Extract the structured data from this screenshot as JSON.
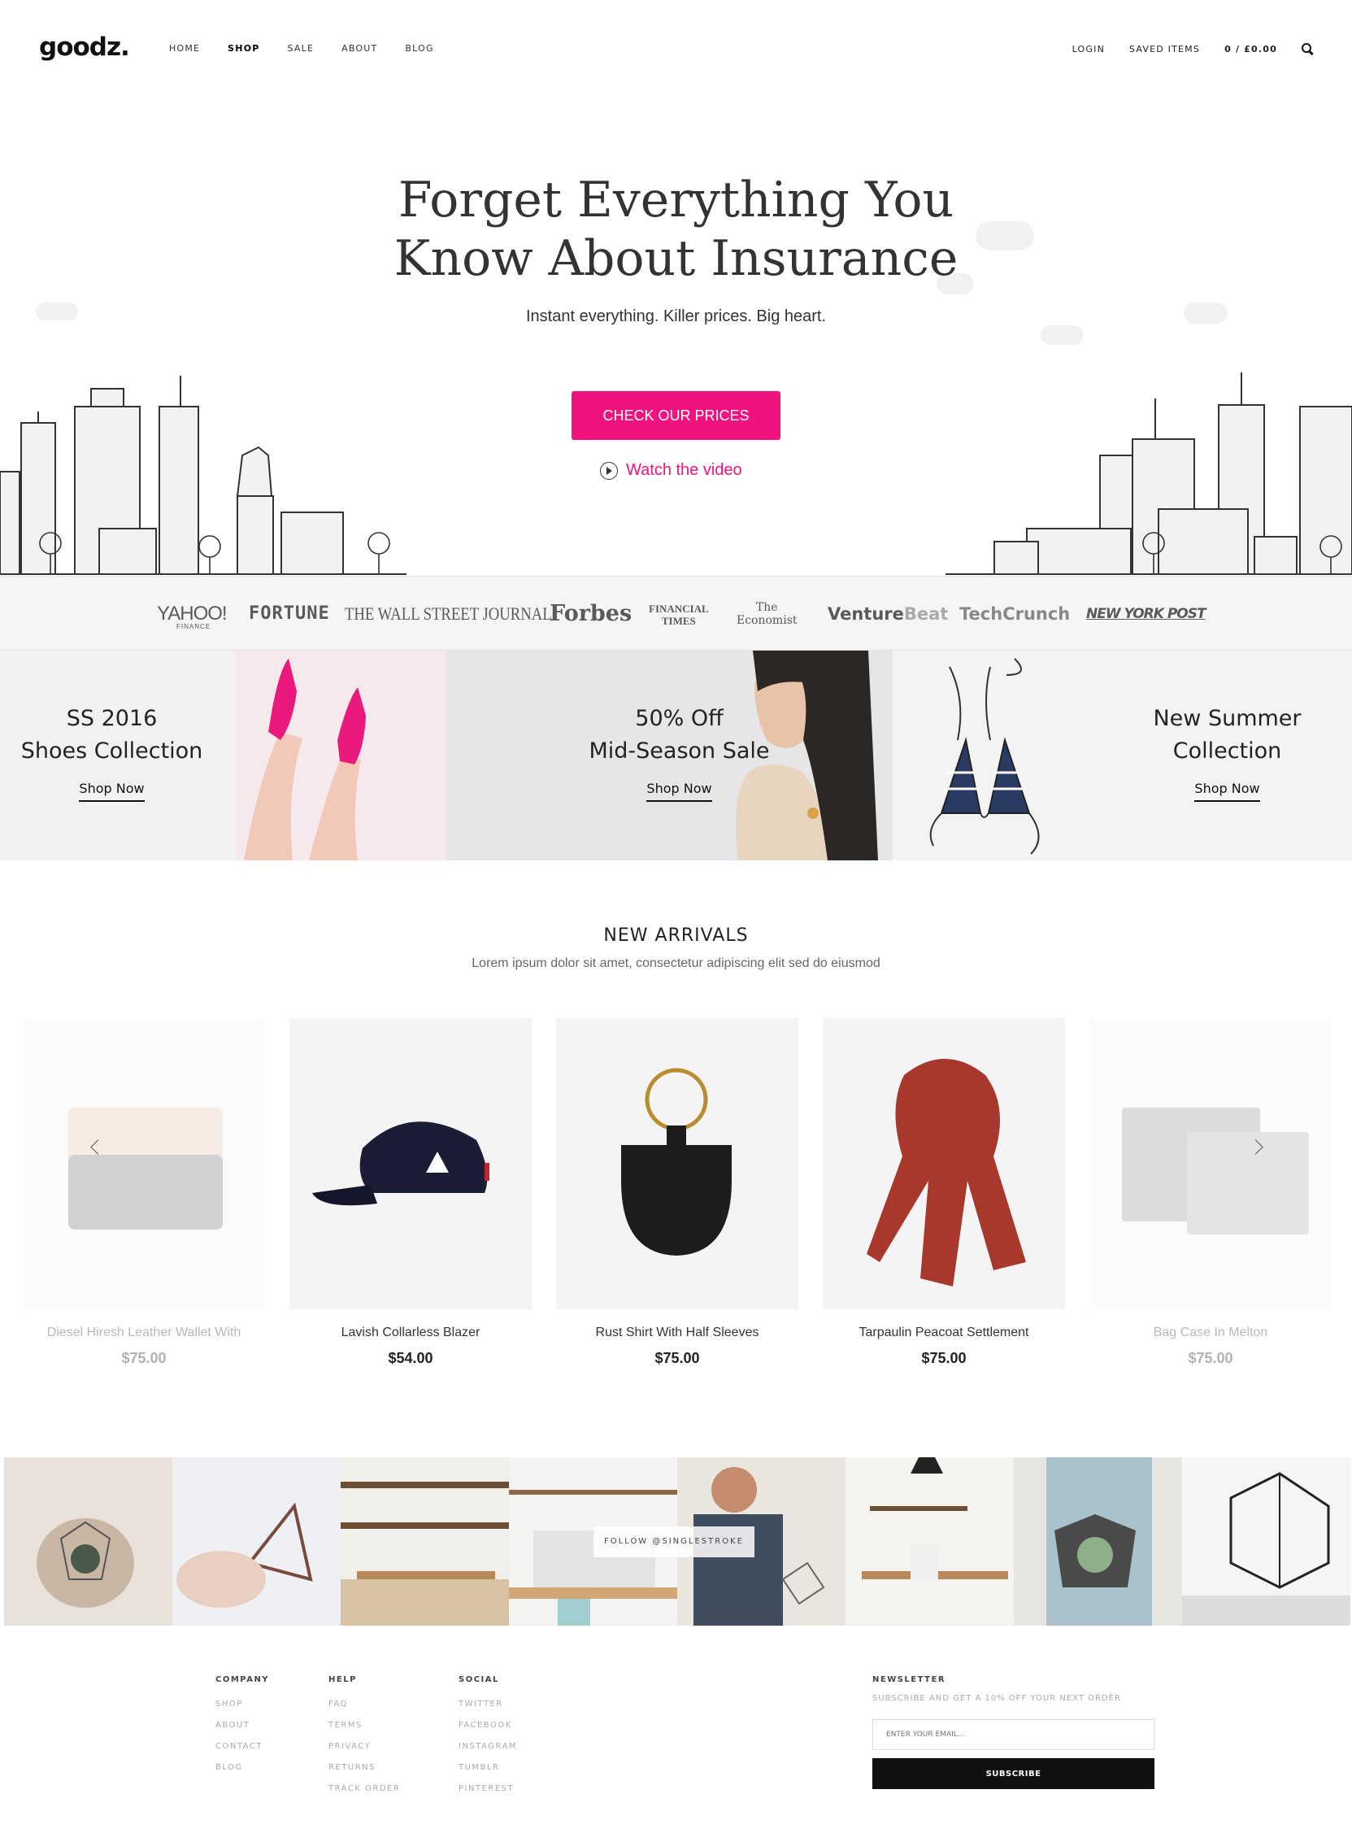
{
  "header": {
    "logo": "goodz.",
    "nav": [
      "HOME",
      "SHOP",
      "SALE",
      "ABOUT",
      "BLOG"
    ],
    "active_nav": "SHOP",
    "login": "LOGIN",
    "saved": "SAVED ITEMS",
    "cart": "0 / £0.00",
    "search_icon": "search-icon"
  },
  "hero": {
    "title_line1": "Forget Everything You",
    "title_line2": "Know About Insurance",
    "subtitle": "Instant everything. Killer prices. Big heart.",
    "cta": "CHECK OUR PRICES",
    "video_link": "Watch the video",
    "accent_color": "#f0127f"
  },
  "press": [
    "YAHOO!",
    "FINANCE",
    "FORTUNE",
    "THE WALL STREET JOURNAL.",
    "Forbes",
    "FINANCIAL",
    "TIMES",
    "The",
    "Economist",
    "Venture",
    "Beat",
    "TechCrunch",
    "NEW YORK POST"
  ],
  "banners": [
    {
      "line1": "SS 2016",
      "line2": "Shoes Collection",
      "link": "Shop Now"
    },
    {
      "line1": "50% Off",
      "line2": "Mid-Season Sale",
      "link": "Shop Now"
    },
    {
      "line1": "New Summer",
      "line2": "Collection",
      "link": "Shop Now"
    }
  ],
  "new_arrivals": {
    "title": "NEW ARRIVALS",
    "subtitle": "Lorem ipsum dolor sit amet, consectetur adipiscing elit sed do eiusmod",
    "products": [
      {
        "name": "Diesel Hiresh Leather Wallet With",
        "price": "$75.00"
      },
      {
        "name": "Lavish Collarless Blazer",
        "price": "$54.00"
      },
      {
        "name": "Rust Shirt With Half Sleeves",
        "price": "$75.00"
      },
      {
        "name": "Tarpaulin Peacoat Settlement",
        "price": "$75.00"
      },
      {
        "name": "Bag Case In Melton",
        "price": "$75.00"
      }
    ]
  },
  "instagram": {
    "follow": "FOLLOW @SINGLESTROKE"
  },
  "footer": {
    "company": {
      "title": "COMPANY",
      "links": [
        "SHOP",
        "ABOUT",
        "CONTACT",
        "BLOG"
      ]
    },
    "help": {
      "title": "HELP",
      "links": [
        "FAQ",
        "TERMS",
        "PRIVACY",
        "RETURNS",
        "TRACK ORDER"
      ]
    },
    "social": {
      "title": "SOCIAL",
      "links": [
        "TWITTER",
        "FACEBOOK",
        "INSTAGRAM",
        "TUMBLR",
        "PINTEREST"
      ]
    },
    "newsletter": {
      "title": "NEWSLETTER",
      "text": "SUBSCRIBE AND GET A 10% OFF YOUR NEXT ORDER",
      "placeholder": "ENTER YOUR EMAIL...",
      "button": "SUBSCRIBE"
    }
  }
}
